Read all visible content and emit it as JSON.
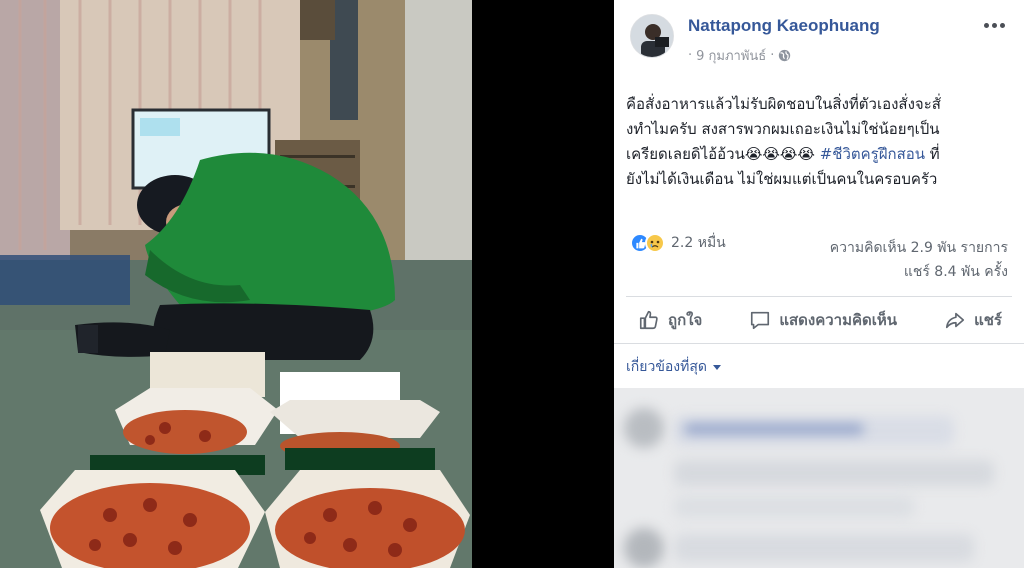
{
  "post": {
    "author": "Nattapong Kaeophuang",
    "date": "9 กุมภาพันธ์",
    "date_separator": "·",
    "lines": {
      "l1": "คือสั่งอาหารแล้วไม่รับผิดชอบในสิ่งที่ตัวเองสั่งจะสั่",
      "l2": "งทำไมครับ สงสารพวกผมเถอะเงินไม่ใช่น้อยๆเป็น",
      "l3_pre": "เครียดเลยดิไอ้อ้วน😭😭😭😭 ",
      "hashtag": "#ชีวิตครูฝึกสอน",
      "l3_post": " ที่",
      "l4": "ยังไม่ได้เงินเดือน ไม่ใช่ผมแต่เป็นคนในครอบครัว"
    }
  },
  "engagement": {
    "reactions_count": "2.2 หมื่น",
    "comments": "ความคิดเห็น 2.9 พัน รายการ",
    "shares": "แชร์ 8.4 พัน ครั้ง"
  },
  "actions": {
    "like": "ถูกใจ",
    "comment": "แสดงความคิดเห็น",
    "share": "แชร์"
  },
  "comments_filter": "เกี่ยวข้องที่สุด",
  "icons": [
    "globe-icon",
    "more-icon",
    "like-reaction-icon",
    "sad-reaction-icon",
    "thumb-up-icon",
    "comment-icon",
    "share-icon",
    "dropdown-caret-icon"
  ],
  "colors": {
    "link": "#365899",
    "muted": "#606770",
    "like_blue": "#2e89ff",
    "viewer_bg": "#000000"
  }
}
